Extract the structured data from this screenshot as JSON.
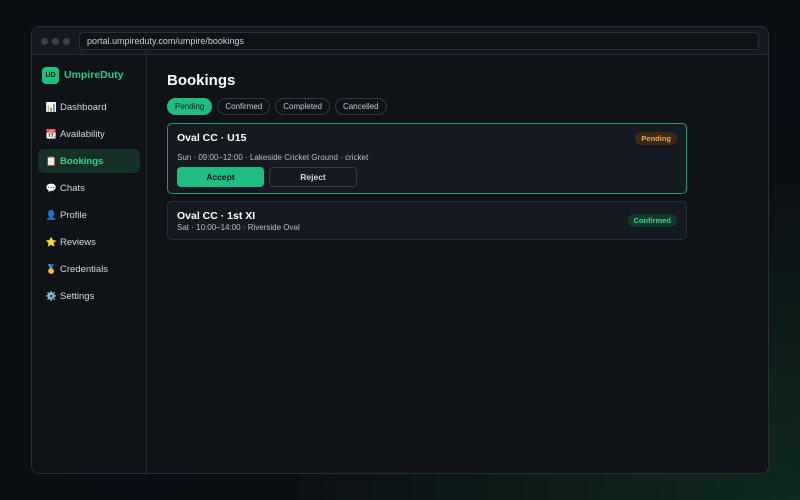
{
  "browser": {
    "url": "portal.umpireduty.com/umpire/bookings"
  },
  "brand": {
    "logo_text": "UD",
    "name": "UmpireDuty"
  },
  "sidebar": {
    "items": [
      {
        "icon": "📊",
        "icon_name": "bar-chart-icon",
        "label": "Dashboard"
      },
      {
        "icon": "📆",
        "icon_name": "calendar-icon",
        "label": "Availability"
      },
      {
        "icon": "📋",
        "icon_name": "clipboard-icon",
        "label": "Bookings",
        "active": true
      },
      {
        "icon": "💬",
        "icon_name": "speech-bubble-icon",
        "label": "Chats"
      },
      {
        "icon": "👤",
        "icon_name": "user-icon",
        "label": "Profile"
      },
      {
        "icon": "⭐",
        "icon_name": "star-icon",
        "label": "Reviews"
      },
      {
        "icon": "🥇",
        "icon_name": "medal-icon",
        "label": "Credentials"
      },
      {
        "icon": "⚙️",
        "icon_name": "gear-icon",
        "label": "Settings"
      }
    ]
  },
  "main": {
    "title": "Bookings",
    "tabs": [
      {
        "label": "Pending",
        "active": true
      },
      {
        "label": "Confirmed"
      },
      {
        "label": "Completed"
      },
      {
        "label": "Cancelled"
      }
    ],
    "bookings": [
      {
        "title": "Oval CC · U15",
        "meta": "Sun · 09:00–12:00 · Lakeside Cricket Ground · cricket",
        "status": "Pending",
        "accept_label": "Accept",
        "reject_label": "Reject"
      },
      {
        "title": "Oval CC · 1st XI",
        "meta": "Sat · 10:00–14:00 · Riverside Oval",
        "status": "Confirmed"
      }
    ]
  },
  "colors": {
    "accent": "#1fbd81",
    "pending": "#f0a53a",
    "confirmed": "#2bd493",
    "background": "#0f1318"
  }
}
